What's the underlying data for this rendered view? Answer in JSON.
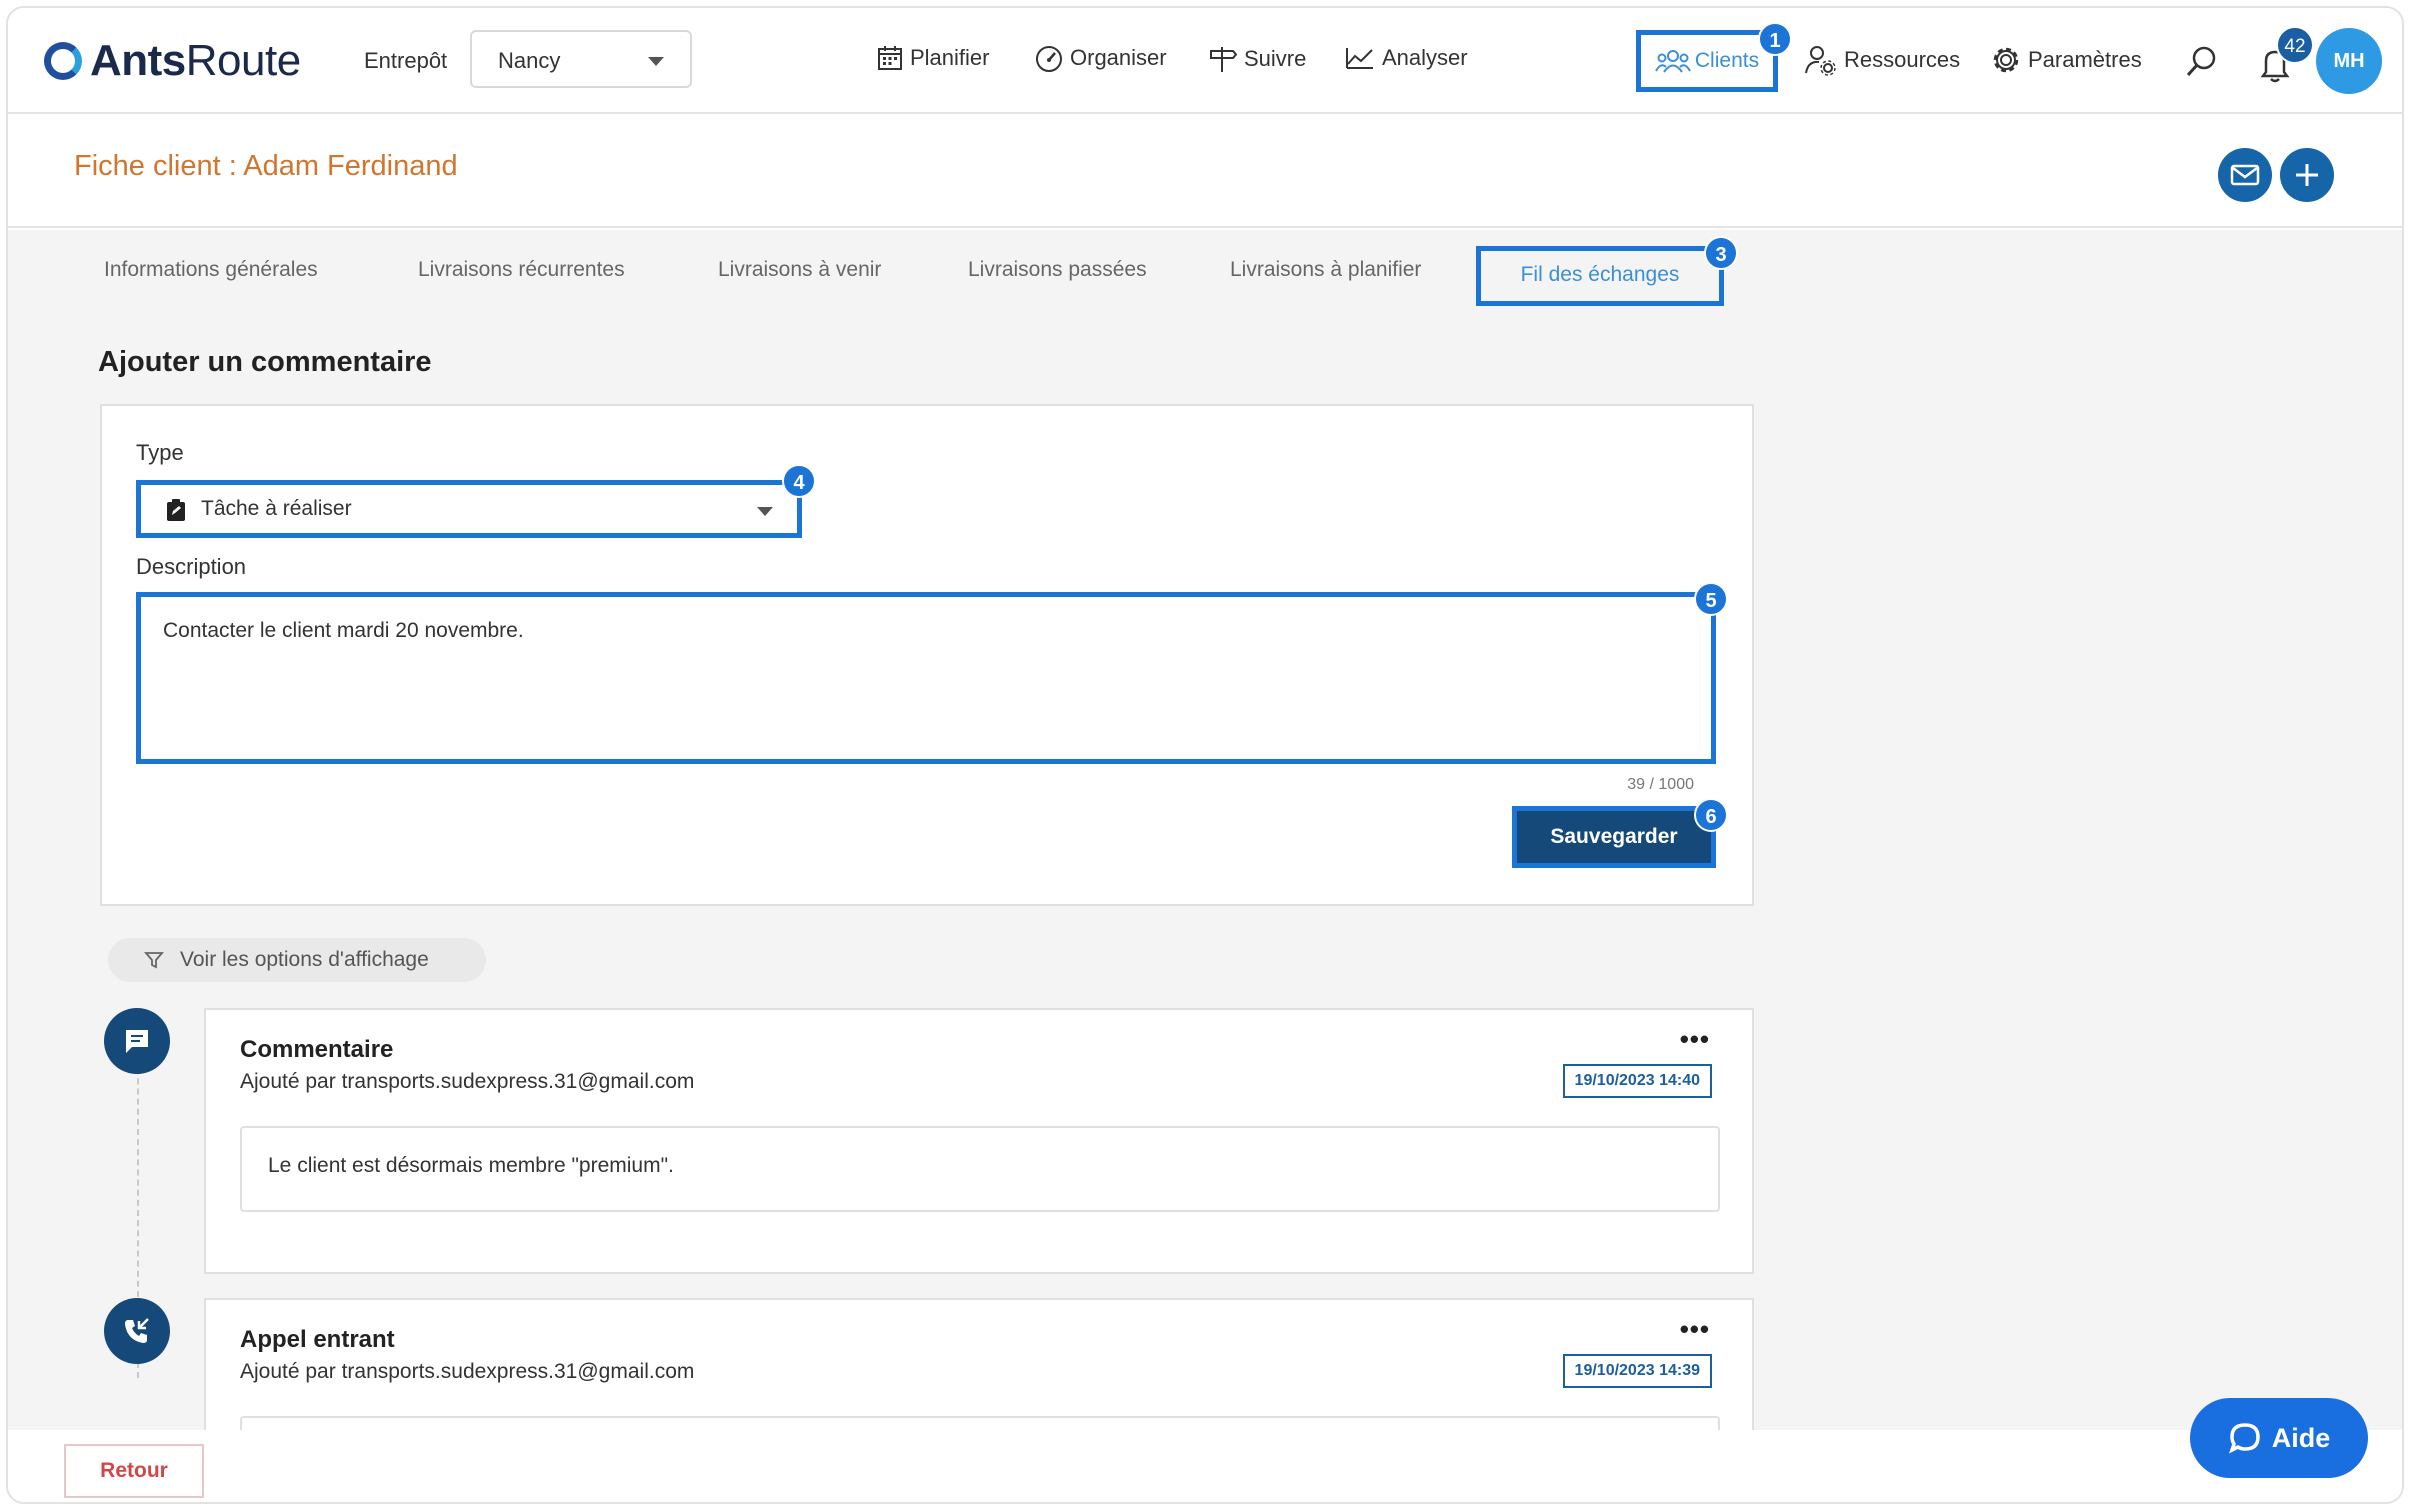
{
  "app": {
    "logo_bold": "Ants",
    "logo_light": "Route"
  },
  "header": {
    "warehouse_label": "Entrepôt",
    "warehouse_value": "Nancy",
    "nav": {
      "planifier": "Planifier",
      "organiser": "Organiser",
      "suivre": "Suivre",
      "analyser": "Analyser",
      "clients": "Clients",
      "ressources": "Ressources",
      "parametres": "Paramètres"
    },
    "notification_count": "42",
    "avatar_initials": "MH"
  },
  "title_bar": {
    "title": "Fiche client : Adam Ferdinand"
  },
  "tabs": {
    "info": "Informations générales",
    "recurrent": "Livraisons récurrentes",
    "upcoming": "Livraisons à venir",
    "past": "Livraisons passées",
    "to_plan": "Livraisons à planifier",
    "exchanges": "Fil des échanges"
  },
  "form": {
    "section_title": "Ajouter un commentaire",
    "type_label": "Type",
    "type_value": "Tâche à réaliser",
    "description_label": "Description",
    "description_value": "Contacter le client mardi 20 novembre.",
    "counter": "39 / 1000",
    "save_label": "Sauvegarder"
  },
  "filter": {
    "label": "Voir les options d'affichage"
  },
  "entries": [
    {
      "title": "Commentaire",
      "author": "Ajouté par transports.sudexpress.31@gmail.com",
      "date": "19/10/2023 14:40",
      "body": "Le client est désormais membre \"premium\"."
    },
    {
      "title": "Appel entrant",
      "author": "Ajouté par transports.sudexpress.31@gmail.com",
      "date": "19/10/2023 14:39"
    }
  ],
  "annotations": [
    "1",
    "3",
    "4",
    "5",
    "6"
  ],
  "footer": {
    "back_label": "Retour",
    "help_label": "Aide"
  },
  "colors": {
    "highlight": "#1b74d6",
    "primary": "#14497a",
    "title": "#d1762f",
    "help": "#1a6fe0"
  }
}
